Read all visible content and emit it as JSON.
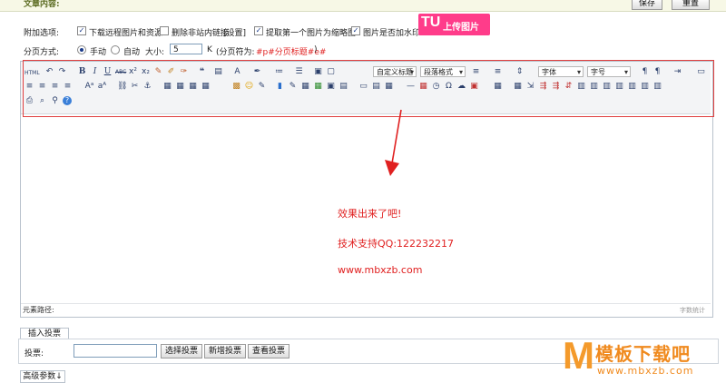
{
  "header": {
    "title": "文章内容:",
    "save_label": "保存",
    "reset_label": "重置"
  },
  "options": {
    "label": "附加选项:",
    "items": [
      {
        "label": "下载远程图片和资源",
        "checked": true
      },
      {
        "label": "删除非站内链接",
        "checked": false
      },
      {
        "label": "[设置]",
        "checked": null
      },
      {
        "label": "提取第一个图片为缩略图",
        "checked": true
      },
      {
        "label": "图片是否加水印",
        "checked": true
      }
    ],
    "upload_tu": "TU",
    "upload_label": "上传图片"
  },
  "paging": {
    "label": "分页方式:",
    "manual": "手动",
    "auto": "自动",
    "size_label": "大小:",
    "size_value": "5",
    "unit": "K",
    "separator_label": "(分页符为:",
    "separator_value": "#p#分页标题#e#",
    "separator_close": ")"
  },
  "toolbar": {
    "custom_title": "自定义标题",
    "paragraph": "段落格式",
    "font": "字体",
    "size": "字号"
  },
  "editor": {
    "line1": "效果出来了吧!",
    "line2": "技术支持QQ:122232217",
    "line3": "www.mbxzb.com",
    "path_label": "元素路径:",
    "word_count": "字数统计"
  },
  "vote": {
    "tab_label": "插入投票",
    "label": "投票:",
    "input_value": "",
    "select_label": "选择投票",
    "add_label": "新增投票",
    "view_label": "查看投票"
  },
  "advanced": {
    "label": "高级参数↓"
  },
  "watermark": {
    "mark": "M",
    "cn": "模板下载吧",
    "url": "www.mbxzb.com"
  },
  "colors": {
    "accent_red": "#e02020",
    "upload_pink": "#ff3c8a",
    "watermark_orange": "#f08a1e"
  }
}
